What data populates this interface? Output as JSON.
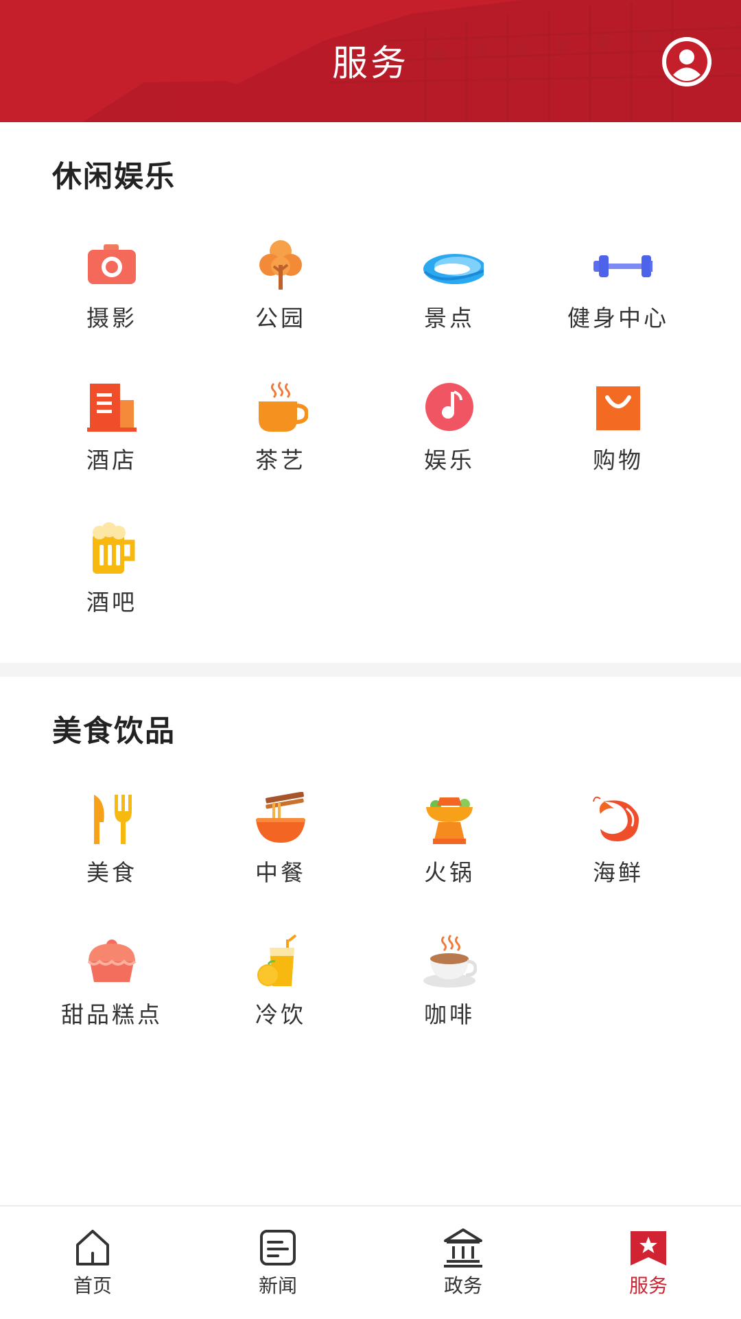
{
  "header": {
    "title": "服务"
  },
  "colors": {
    "brand_red": "#c61f2c",
    "active_tab": "#d12331"
  },
  "sections": [
    {
      "title": "休闲娱乐",
      "items": [
        {
          "label": "摄影",
          "icon": "camera-icon"
        },
        {
          "label": "公园",
          "icon": "tree-icon"
        },
        {
          "label": "景点",
          "icon": "scenic-spot-icon"
        },
        {
          "label": "健身中心",
          "icon": "dumbbell-icon"
        },
        {
          "label": "酒店",
          "icon": "hotel-icon"
        },
        {
          "label": "茶艺",
          "icon": "tea-cup-icon"
        },
        {
          "label": "娱乐",
          "icon": "music-note-icon"
        },
        {
          "label": "购物",
          "icon": "shopping-bag-icon"
        },
        {
          "label": "酒吧",
          "icon": "beer-mug-icon"
        }
      ]
    },
    {
      "title": "美食饮品",
      "items": [
        {
          "label": "美食",
          "icon": "fork-knife-icon"
        },
        {
          "label": "中餐",
          "icon": "noodle-bowl-icon"
        },
        {
          "label": "火锅",
          "icon": "hotpot-icon"
        },
        {
          "label": "海鲜",
          "icon": "shrimp-icon"
        },
        {
          "label": "甜品糕点",
          "icon": "cupcake-icon"
        },
        {
          "label": "冷饮",
          "icon": "cold-drink-icon"
        },
        {
          "label": "咖啡",
          "icon": "coffee-cup-icon"
        }
      ]
    }
  ],
  "bottom_nav": [
    {
      "label": "首页",
      "icon": "home-icon",
      "active": false
    },
    {
      "label": "新闻",
      "icon": "news-icon",
      "active": false
    },
    {
      "label": "政务",
      "icon": "government-icon",
      "active": false
    },
    {
      "label": "服务",
      "icon": "service-bookmark-icon",
      "active": true
    }
  ]
}
